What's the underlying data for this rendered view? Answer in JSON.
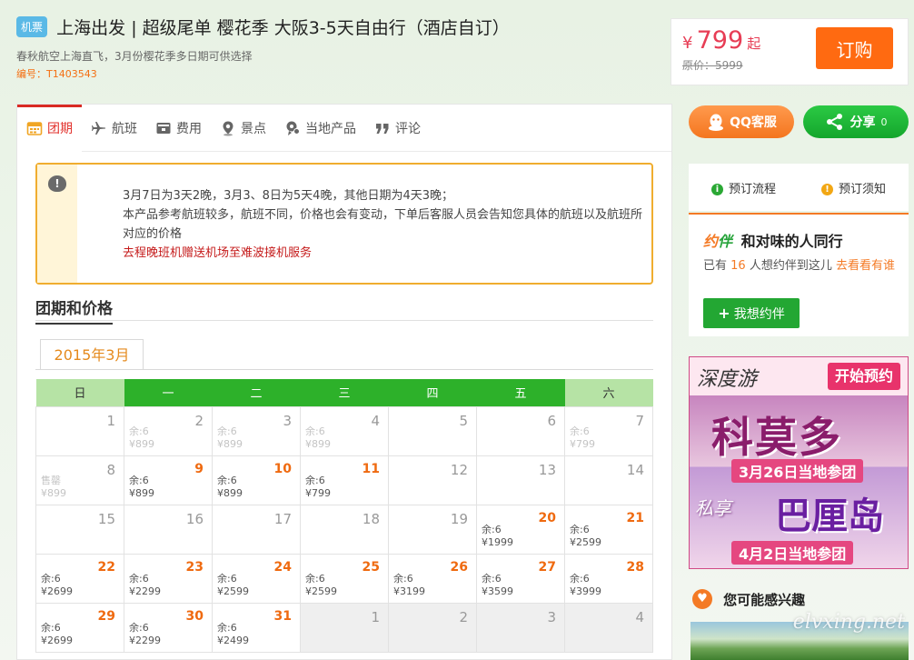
{
  "header": {
    "badge": "机票",
    "title": "上海出发 | 超级尾单 樱花季 大阪3-5天自由行（酒店自订）",
    "subtitle": "春秋航空上海直飞，3月份樱花季多日期可供选择",
    "code": "编号：T1403543"
  },
  "price": {
    "currency": "¥",
    "amount": "799",
    "suffix": "起",
    "original": "原价：5999",
    "order_label": "订购"
  },
  "tabs": [
    {
      "label": "团期",
      "icon": "calendar-icon",
      "active": true
    },
    {
      "label": "航班",
      "icon": "airplane-icon"
    },
    {
      "label": "费用",
      "icon": "wallet-icon"
    },
    {
      "label": "景点",
      "icon": "location-pin-icon"
    },
    {
      "label": "当地产品",
      "icon": "local-product-icon"
    },
    {
      "label": "评论",
      "icon": "quote-icon"
    }
  ],
  "notice": {
    "line1": "3月7日为3天2晚，3月3、8日为5天4晚，其他日期为4天3晚；",
    "line2": "本产品参考航班较多，航班不同，价格也会有变动，下单后客服人员会告知您具体的航班以及航班所对应的价格",
    "line3": "去程晚班机赠送机场至难波接机服务"
  },
  "section": {
    "title": "团期和价格",
    "month": "2015年3月"
  },
  "calendar": {
    "weekdays": [
      "日",
      "一",
      "二",
      "三",
      "四",
      "五",
      "六"
    ],
    "rows": [
      [
        {
          "day": "1",
          "active": false
        },
        {
          "day": "2",
          "active": false,
          "line1": "余:6",
          "line2": "¥899",
          "dim": true
        },
        {
          "day": "3",
          "active": false,
          "line1": "余:6",
          "line2": "¥899",
          "dim": true
        },
        {
          "day": "4",
          "active": false,
          "line1": "余:6",
          "line2": "¥899",
          "dim": true
        },
        {
          "day": "5",
          "active": false
        },
        {
          "day": "6",
          "active": false
        },
        {
          "day": "7",
          "active": false,
          "line1": "余:6",
          "line2": "¥799",
          "dim": true
        }
      ],
      [
        {
          "day": "8",
          "active": false,
          "line1": "售罄",
          "line2": "¥899",
          "dim": true
        },
        {
          "day": "9",
          "active": true,
          "line1": "余:6",
          "line2": "¥899"
        },
        {
          "day": "10",
          "active": true,
          "line1": "余:6",
          "line2": "¥899"
        },
        {
          "day": "11",
          "active": true,
          "line1": "余:6",
          "line2": "¥799"
        },
        {
          "day": "12",
          "active": false
        },
        {
          "day": "13",
          "active": false
        },
        {
          "day": "14",
          "active": false
        }
      ],
      [
        {
          "day": "15",
          "active": false
        },
        {
          "day": "16",
          "active": false
        },
        {
          "day": "17",
          "active": false
        },
        {
          "day": "18",
          "active": false
        },
        {
          "day": "19",
          "active": false
        },
        {
          "day": "20",
          "active": true,
          "line1": "余:6",
          "line2": "¥1999"
        },
        {
          "day": "21",
          "active": true,
          "line1": "余:6",
          "line2": "¥2599"
        }
      ],
      [
        {
          "day": "22",
          "active": true,
          "line1": "余:6",
          "line2": "¥2699"
        },
        {
          "day": "23",
          "active": true,
          "line1": "余:6",
          "line2": "¥2299"
        },
        {
          "day": "24",
          "active": true,
          "line1": "余:6",
          "line2": "¥2599"
        },
        {
          "day": "25",
          "active": true,
          "line1": "余:6",
          "line2": "¥2599"
        },
        {
          "day": "26",
          "active": true,
          "line1": "余:6",
          "line2": "¥3199"
        },
        {
          "day": "27",
          "active": true,
          "line1": "余:6",
          "line2": "¥3599"
        },
        {
          "day": "28",
          "active": true,
          "line1": "余:6",
          "line2": "¥3999"
        }
      ],
      [
        {
          "day": "29",
          "active": true,
          "line1": "余:6",
          "line2": "¥2699"
        },
        {
          "day": "30",
          "active": true,
          "line1": "余:6",
          "line2": "¥2299"
        },
        {
          "day": "31",
          "active": true,
          "line1": "余:6",
          "line2": "¥2499"
        },
        {
          "day": "1",
          "active": false,
          "grey": true
        },
        {
          "day": "2",
          "active": false,
          "grey": true
        },
        {
          "day": "3",
          "active": false,
          "grey": true
        },
        {
          "day": "4",
          "active": false,
          "grey": true
        }
      ]
    ]
  },
  "sidebar": {
    "qq_label": "QQ客服",
    "share_label": "分享",
    "share_count": "0",
    "process_label": "预订流程",
    "notice_label": "预订须知",
    "yueban": {
      "logo_a": "约",
      "logo_b": "伴",
      "title": "和对味的人同行",
      "text_pre": "已有 ",
      "count": "16",
      "text_mid": " 人想约伴到这儿 ",
      "link": "去看看有谁",
      "button": "我想约伴"
    },
    "ad": {
      "brand": "深度游",
      "cta": "开始预约",
      "dest1": "科莫多",
      "date1": "3月26日当地参团",
      "tag2": "私享",
      "dest2": "巴厘岛",
      "date2": "4月2日当地参团"
    },
    "interest_title": "您可能感兴趣",
    "watermark": "elvxing.net"
  },
  "colors": {
    "accent": "#ff6a11",
    "price": "#e73d55",
    "weekday_header": "#2db12a",
    "weekend_header": "#b6e3a5",
    "active_date": "#ef6a10",
    "notice_border": "#f0ad2f",
    "notice_red": "#c51b1b"
  }
}
